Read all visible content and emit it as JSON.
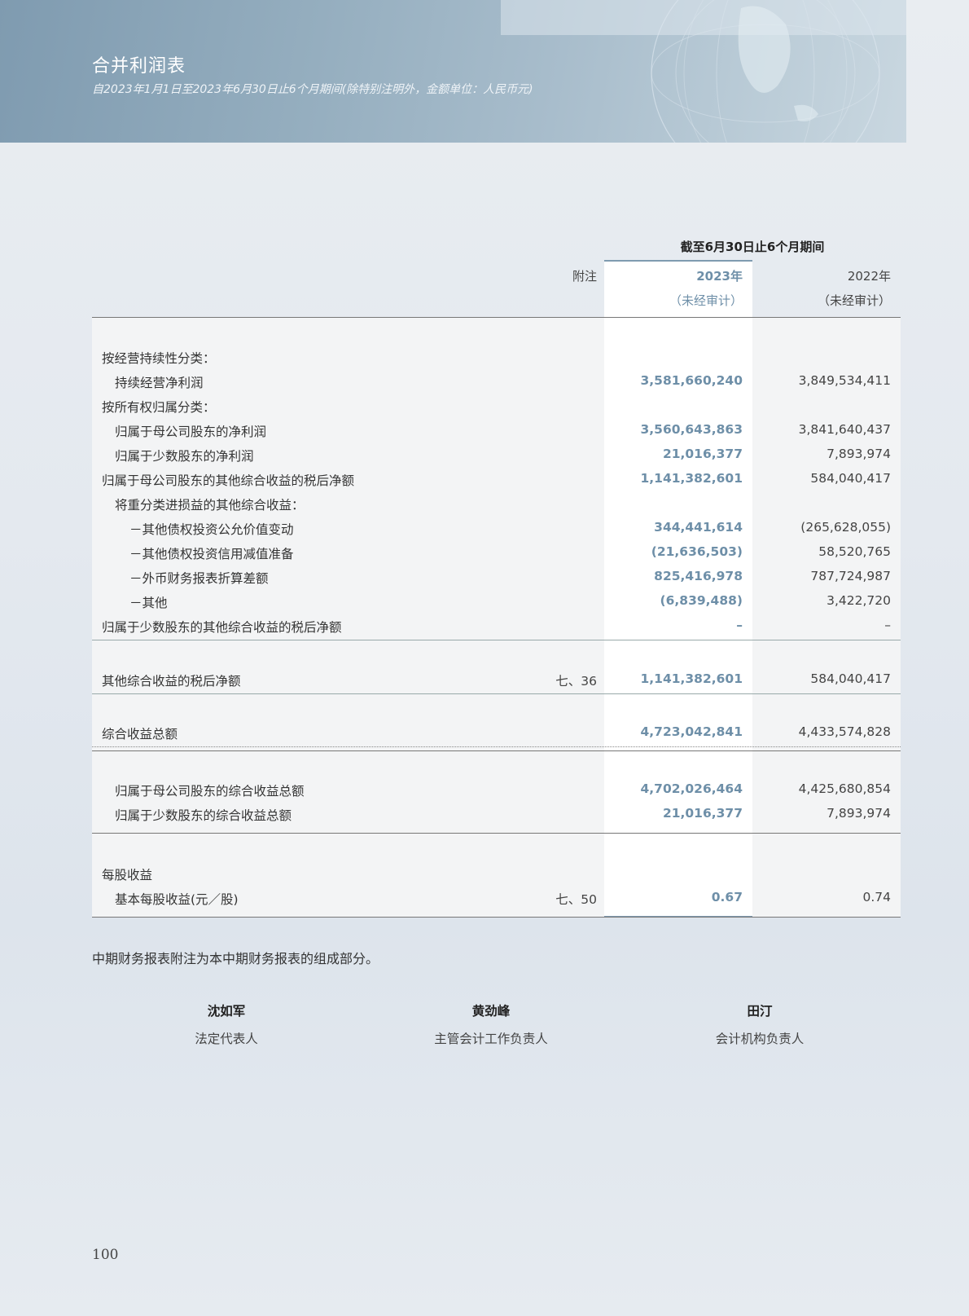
{
  "header": {
    "title": "合并利润表",
    "subtitle": "自2023年1月1日至2023年6月30日止6个月期间(除特别注明外，金额单位：人民币元)"
  },
  "table": {
    "period_header": "截至6月30日止6个月期间",
    "note_header": "附注",
    "year_current": "2023年",
    "year_current_sub": "（未经审计）",
    "year_prev": "2022年",
    "year_prev_sub": "（未经审计）",
    "rows": [
      {
        "label": "按经营持续性分类：",
        "note": "",
        "cur": "",
        "prev": ""
      },
      {
        "label": "持续经营净利润",
        "note": "",
        "cur": "3,581,660,240",
        "prev": "3,849,534,411"
      },
      {
        "label": "按所有权归属分类：",
        "note": "",
        "cur": "",
        "prev": ""
      },
      {
        "label": "归属于母公司股东的净利润",
        "note": "",
        "cur": "3,560,643,863",
        "prev": "3,841,640,437"
      },
      {
        "label": "归属于少数股东的净利润",
        "note": "",
        "cur": "21,016,377",
        "prev": "7,893,974"
      },
      {
        "label": "归属于母公司股东的其他综合收益的税后净额",
        "note": "",
        "cur": "1,141,382,601",
        "prev": "584,040,417"
      },
      {
        "label": "将重分类进损益的其他综合收益：",
        "note": "",
        "cur": "",
        "prev": ""
      },
      {
        "label": "－其他债权投资公允价值变动",
        "note": "",
        "cur": "344,441,614",
        "prev": "(265,628,055)"
      },
      {
        "label": "－其他债权投资信用减值准备",
        "note": "",
        "cur": "(21,636,503)",
        "prev": "58,520,765"
      },
      {
        "label": "－外币财务报表折算差额",
        "note": "",
        "cur": "825,416,978",
        "prev": "787,724,987"
      },
      {
        "label": "－其他",
        "note": "",
        "cur": "(6,839,488)",
        "prev": "3,422,720"
      },
      {
        "label": "归属于少数股东的其他综合收益的税后净额",
        "note": "",
        "cur": "–",
        "prev": "–"
      },
      {
        "label": "其他综合收益的税后净额",
        "note": "七、36",
        "cur": "1,141,382,601",
        "prev": "584,040,417"
      },
      {
        "label": "综合收益总额",
        "note": "",
        "cur": "4,723,042,841",
        "prev": "4,433,574,828"
      },
      {
        "label": "归属于母公司股东的综合收益总额",
        "note": "",
        "cur": "4,702,026,464",
        "prev": "4,425,680,854"
      },
      {
        "label": "归属于少数股东的综合收益总额",
        "note": "",
        "cur": "21,016,377",
        "prev": "7,893,974"
      },
      {
        "label": "每股收益",
        "note": "",
        "cur": "",
        "prev": ""
      },
      {
        "label": "基本每股收益(元／股)",
        "note": "七、50",
        "cur": "0.67",
        "prev": "0.74"
      }
    ]
  },
  "footnote": "中期财务报表附注为本中期财务报表的组成部分。",
  "signatures": [
    {
      "name": "沈如军",
      "role": "法定代表人"
    },
    {
      "name": "黄劲峰",
      "role": "主管会计工作负责人"
    },
    {
      "name": "田汀",
      "role": "会计机构负责人"
    }
  ],
  "page_number": "100",
  "colors": {
    "accent": "#6e8fa8",
    "header_bg": "#95aebf"
  }
}
